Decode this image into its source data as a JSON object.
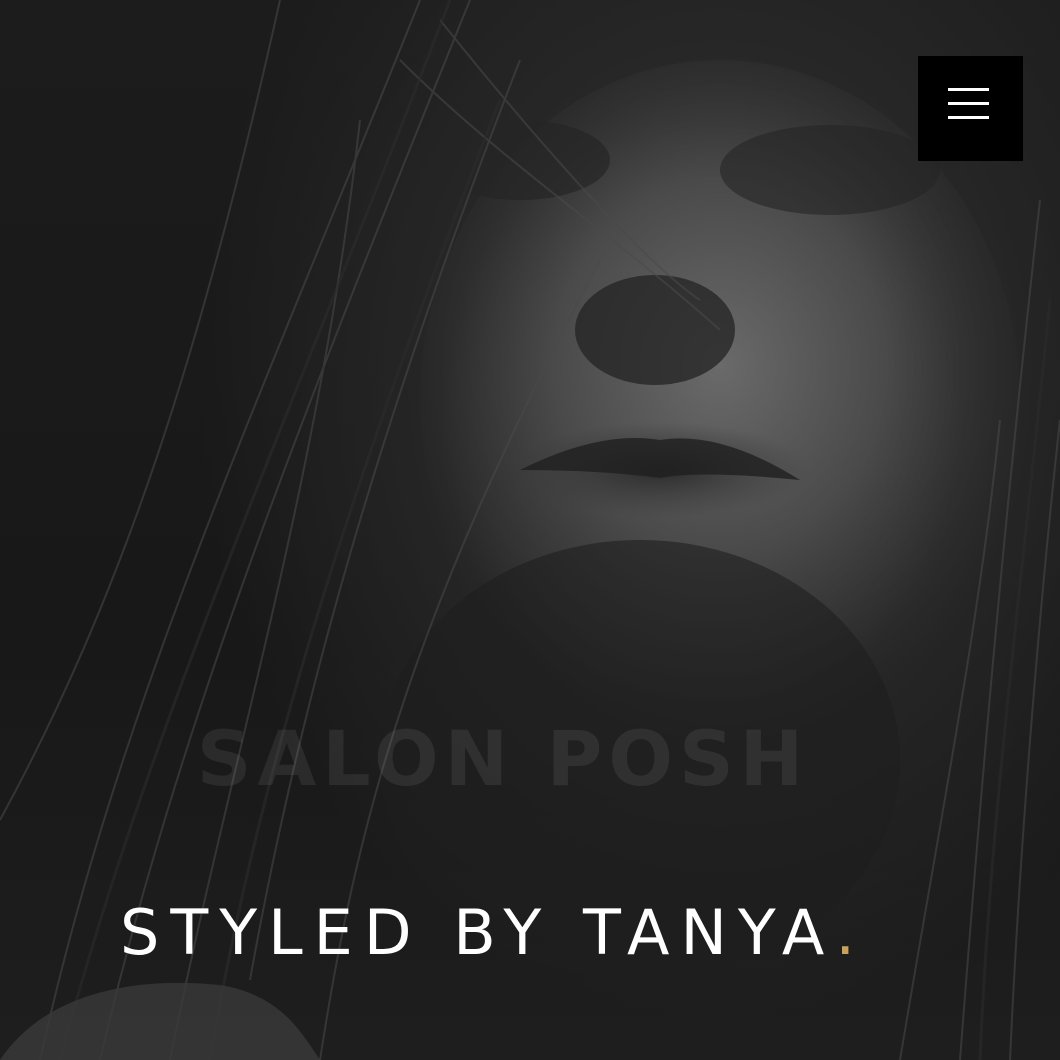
{
  "hero": {
    "image": "black-and-white portrait",
    "watermark_text": "SALON POSH",
    "tagline_text": "STYLED BY TANYA",
    "tagline_dot": ".",
    "accent_color": "#c9a15d"
  },
  "header": {
    "menu_icon": "hamburger-menu-icon"
  }
}
